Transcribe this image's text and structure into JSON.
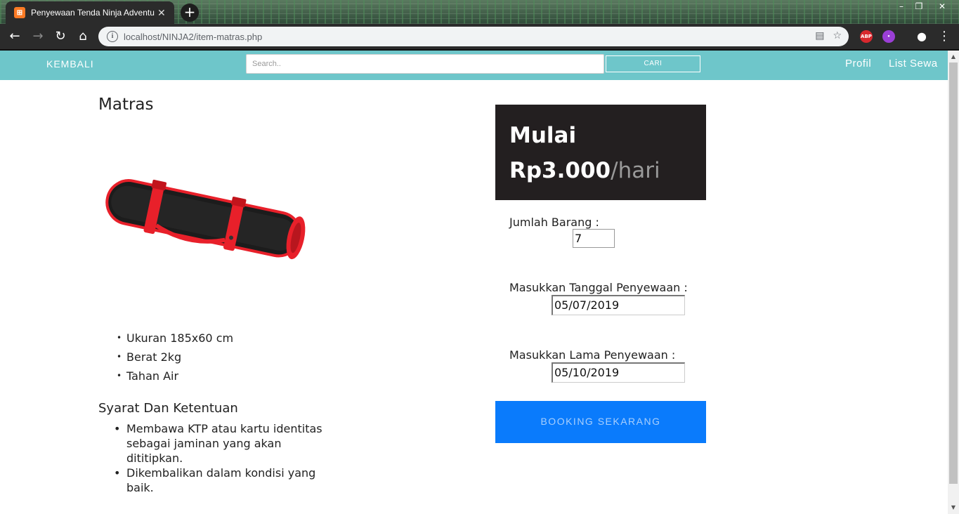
{
  "browser": {
    "tab_title": "Penyewaan Tenda Ninja Adventure",
    "tab_favicon_letter": "⊞",
    "tab_close": "✕",
    "new_tab": "+",
    "url": "localhost/NINJA2/item-matras.php",
    "window_controls": [
      "–",
      "❐",
      "✕"
    ],
    "extensions": [
      "ABP",
      "•"
    ]
  },
  "nav": {
    "back_label": "KEMBALI",
    "search_placeholder": "Search..",
    "search_button": "CARI",
    "profile_label": "Profil",
    "list_label": "List Sewa"
  },
  "product": {
    "title": "Matras",
    "features": [
      "Ukuran 185x60 cm",
      "Berat 2kg",
      "Tahan Air"
    ],
    "terms_title": "Syarat Dan Ketentuan",
    "terms": [
      "Membawa KTP atau kartu identitas sebagai jaminan yang akan dititipkan.",
      "Dikembalikan dalam kondisi yang baik."
    ]
  },
  "price": {
    "label": "Mulai",
    "amount": "Rp3.000",
    "unit": "/hari"
  },
  "form": {
    "qty_label": "Jumlah Barang :",
    "qty_value": "7",
    "start_label": "Masukkan Tanggal Penyewaan :",
    "start_value": "05/07/2019",
    "duration_label": "Masukkan Lama Penyewaan :",
    "duration_value": "05/10/2019",
    "submit_label": "BOOKING SEKARANG"
  },
  "colors": {
    "nav_bg": "#6ec6ca",
    "price_bg": "#231f20",
    "button_bg": "#0a7bfc",
    "mat_body": "#1c1c1c",
    "mat_strap": "#e8202a"
  }
}
